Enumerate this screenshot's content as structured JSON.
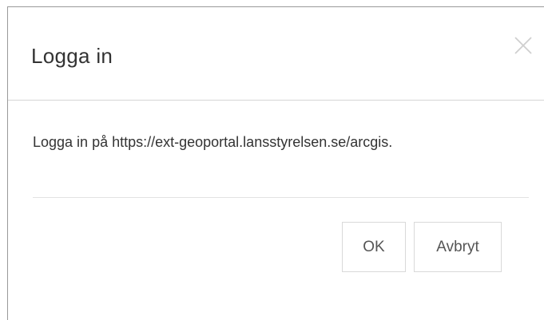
{
  "dialog": {
    "title": "Logga in",
    "message": "Logga in på https://ext-geoportal.lansstyrelsen.se/arcgis.",
    "close_icon": "close-icon",
    "buttons": {
      "ok_label": "OK",
      "cancel_label": "Avbryt"
    }
  },
  "colors": {
    "text": "#333333",
    "border": "#d9d9d9",
    "close_icon": "#cfcfcf"
  }
}
